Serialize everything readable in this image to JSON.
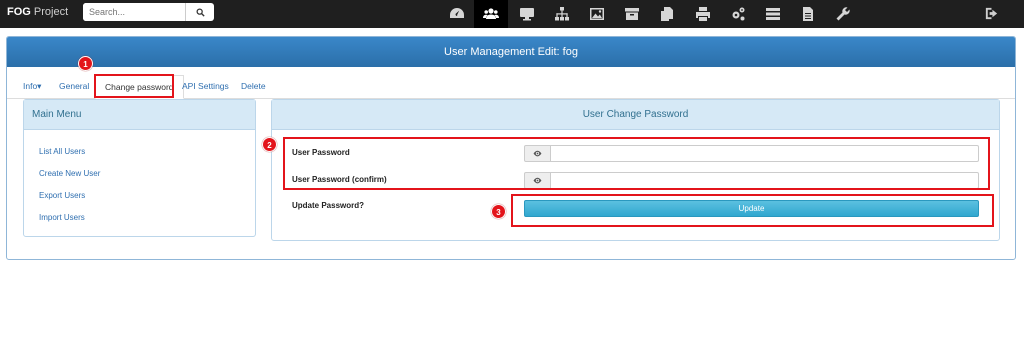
{
  "brand": {
    "bold": "FOG",
    "rest": " Project"
  },
  "search": {
    "placeholder": "Search..."
  },
  "nav_icons": [
    "dashboard-icon",
    "users-icon",
    "hosts-icon",
    "groups-icon",
    "images-icon",
    "storage-icon",
    "snapins-icon",
    "printers-icon",
    "services-icon",
    "tasks-icon",
    "reports-icon",
    "settings-icon"
  ],
  "active_nav": "users-icon",
  "panel": {
    "title": "User Management Edit: fog"
  },
  "tabs": {
    "info": "Info▾",
    "general": "General",
    "change_password": "Change password",
    "api_settings": "API Settings",
    "delete": "Delete"
  },
  "menu": {
    "title": "Main Menu",
    "items": [
      "List All Users",
      "Create New User",
      "Export Users",
      "Import Users"
    ]
  },
  "form": {
    "title": "User Change Password",
    "password_label": "User Password",
    "confirm_label": "User Password (confirm)",
    "update_label": "Update Password?",
    "update_button": "Update",
    "password_value": "",
    "confirm_value": ""
  },
  "markers": [
    "1",
    "2",
    "3"
  ],
  "colors": {
    "highlight": "#e3141b",
    "header": "#2b6fa9",
    "link": "#2f6fb0",
    "button": "#31a7cf"
  }
}
